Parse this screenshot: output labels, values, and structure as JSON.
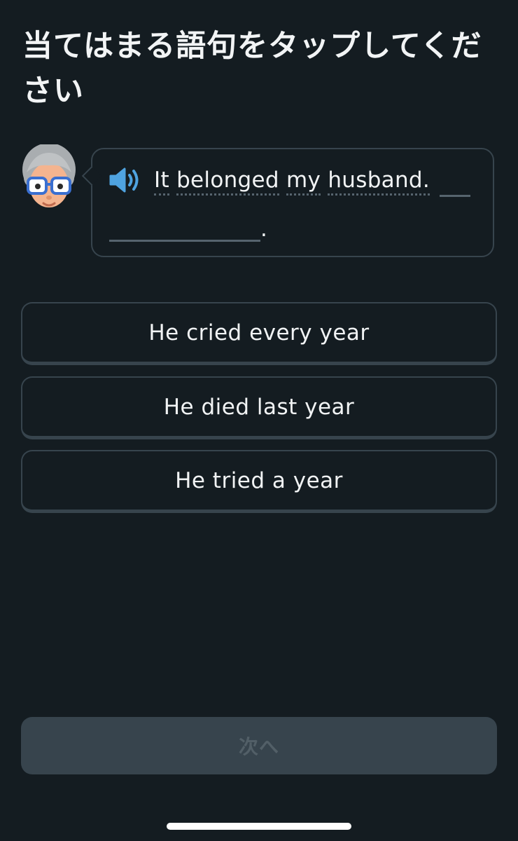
{
  "prompt": {
    "title": "当てはまる語句をタップしてください"
  },
  "character": {
    "avatar_icon": "grandmother-avatar-icon",
    "speaker_icon": "speaker-icon"
  },
  "sentence": {
    "words": [
      "It",
      "belonged",
      "my",
      "husband."
    ],
    "period": "."
  },
  "options": [
    {
      "label": "He cried every year"
    },
    {
      "label": "He died last year"
    },
    {
      "label": "He tried a year"
    }
  ],
  "footer": {
    "next_label": "次へ"
  },
  "colors": {
    "background": "#141c21",
    "border": "#37444d",
    "speaker_blue": "#4fa3e0",
    "disabled_button": "#37444d",
    "disabled_text": "#525f67"
  }
}
